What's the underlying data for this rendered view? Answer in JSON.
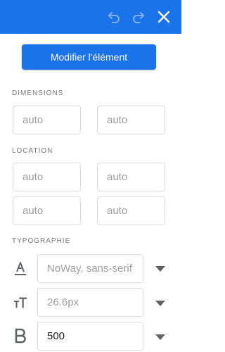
{
  "topbar": {
    "accent_color": "#1a73e8",
    "undo_icon": "undo-icon",
    "redo_icon": "redo-icon",
    "close_icon": "close-icon"
  },
  "actions": {
    "modify_label": "Modifier l'élément"
  },
  "sections": {
    "dimensions": "DIMENSIONS",
    "location": "LOCATION",
    "typography": "TYPOGRAPHIE"
  },
  "dimensions": {
    "width_value": "auto",
    "height_value": "auto"
  },
  "location": {
    "top_value": "auto",
    "right_value": "auto",
    "bottom_value": "auto",
    "left_value": "auto"
  },
  "typography": {
    "font_family_placeholder": "NoWay, sans-serif",
    "font_size_placeholder": "26.6px",
    "font_weight_value": "500",
    "font_color_icon": "text-color-icon",
    "font_size_icon": "text-size-icon",
    "font_weight_icon": "bold-icon"
  }
}
